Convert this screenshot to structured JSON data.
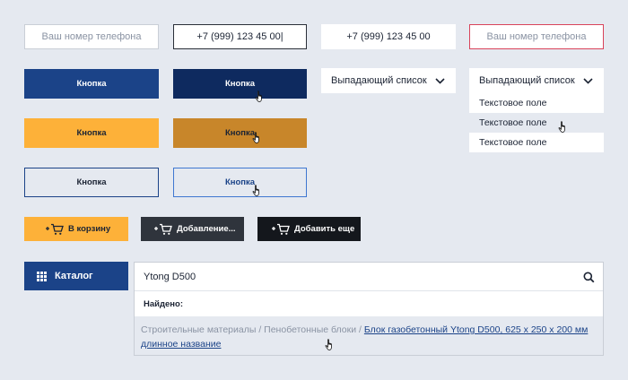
{
  "phone_fields": {
    "placeholder_default": "Ваш номер телефона",
    "value_focused": "+7 (999) 123 45 00|",
    "value_filled": "+7 (999) 123 45 00",
    "placeholder_error": "Ваш номер телефона"
  },
  "primary_buttons": {
    "normal": "Кнопка",
    "hover": "Кнопка"
  },
  "accent_buttons": {
    "normal": "Кнопка",
    "hover": "Кнопка"
  },
  "outline_buttons": {
    "normal": "Кнопка",
    "hover": "Кнопка"
  },
  "dropdown_closed": {
    "label": "Выпадающий список"
  },
  "dropdown_open": {
    "label": "Выпадающий список",
    "options": [
      "Текстовое поле",
      "Текстовое поле",
      "Текстовое поле"
    ]
  },
  "cart_buttons": {
    "add": "В корзину",
    "adding": "Добавление...",
    "add_more": "Добавить еще"
  },
  "catalog": {
    "label": "Каталог"
  },
  "search": {
    "value": "Ytong D500",
    "found_label": "Найдено:",
    "breadcrumb_1": "Строительные материалы",
    "separator": " / ",
    "breadcrumb_2": "Пенобетонные блоки",
    "result_link_line1": "Блок газобетонный Ytong D500, 625 х 250 х 200 мм",
    "result_link_line2": "длинное название"
  },
  "colors": {
    "background": "#e5e9f0",
    "primary": "#1b4388",
    "primary_hover": "#0e2a5f",
    "accent": "#fdb139",
    "accent_hover": "#c8862a",
    "dark_button": "#2f343c",
    "black_button": "#14171c",
    "error_border": "#d9435a"
  },
  "icons": [
    "cart-icon",
    "grid-icon",
    "search-icon",
    "chevron-down-icon",
    "hand-cursor-icon"
  ]
}
